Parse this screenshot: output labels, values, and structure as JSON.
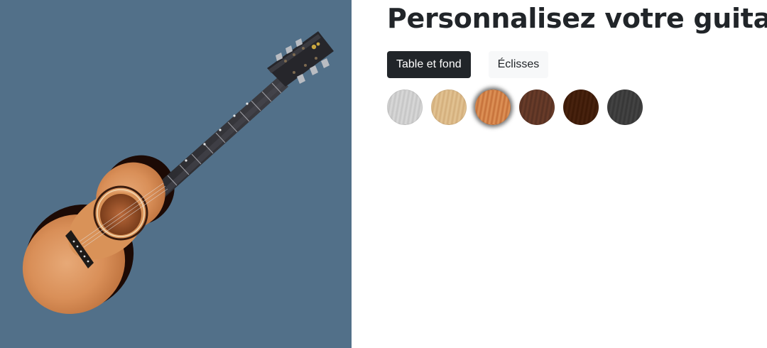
{
  "header": {
    "title": "Personnalisez votre guitare"
  },
  "tabs": [
    {
      "label": "Table et fond",
      "active": true
    },
    {
      "label": "Éclisses",
      "active": false
    }
  ],
  "viewer": {
    "background": "#527089"
  },
  "swatches": [
    {
      "name": "silver-grey",
      "color": "#c4c4c4",
      "color2": "#dadada",
      "selected": false
    },
    {
      "name": "light-maple",
      "color": "#d2ad7a",
      "color2": "#e4c595",
      "selected": false
    },
    {
      "name": "cedar",
      "color": "#c46f38",
      "color2": "#e0955a",
      "selected": true
    },
    {
      "name": "walnut",
      "color": "#553022",
      "color2": "#6c3d2a",
      "selected": false
    },
    {
      "name": "dark-rosewood",
      "color": "#3a1806",
      "color2": "#4a2410",
      "selected": false
    },
    {
      "name": "charcoal",
      "color": "#353535",
      "color2": "#454545",
      "selected": false
    }
  ]
}
